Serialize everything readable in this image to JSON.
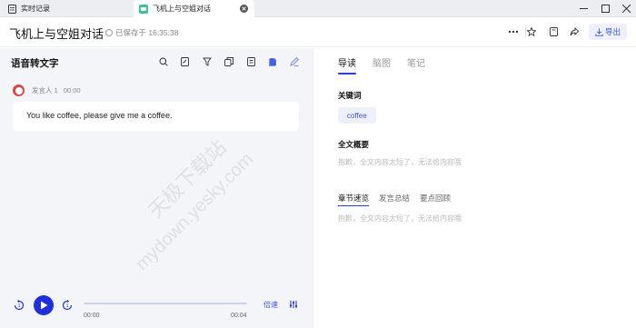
{
  "tabs": [
    {
      "label": "实时记录"
    },
    {
      "label": "飞机上与空姐对话"
    }
  ],
  "header": {
    "title": "飞机上与空姐对话",
    "saved_status": "已保存于 16:35:38",
    "export_label": "导出"
  },
  "left": {
    "title": "语音转文字",
    "speaker_name": "发言人 1",
    "speaker_time": "00:00",
    "transcript": "You like coffee, please give me a coffee."
  },
  "player": {
    "current_time": "00:00",
    "total_time": "00:04",
    "speed_label": "倍速",
    "progress": 0
  },
  "right": {
    "tabs": [
      "导读",
      "脑图",
      "笔记"
    ],
    "keywords_title": "关键词",
    "keywords": [
      "coffee"
    ],
    "summary_title": "全文概要",
    "summary_hint": "抱歉，全文内容太短了，无法给内容哦",
    "subtabs": [
      "章节速览",
      "发言总结",
      "要点回顾"
    ],
    "chapter_hint": "抱歉，全文内容太短了，无法给内容哦"
  },
  "watermark": {
    "line1": "天极下载站",
    "line2": "mydown.yesky.com"
  },
  "colors": {
    "accent": "#3b55d9",
    "panel_bg": "#f4f5f8"
  }
}
